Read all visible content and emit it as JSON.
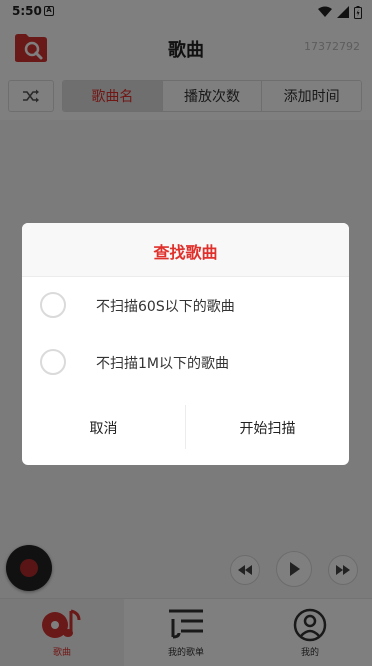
{
  "status_bar": {
    "time": "5:50",
    "notification_badge": "A",
    "icons": [
      "wifi-icon",
      "signal-icon",
      "battery-icon"
    ]
  },
  "header": {
    "title": "歌曲",
    "id_text": "17372792",
    "scan_icon": "folder-search-icon"
  },
  "sort_bar": {
    "shuffle_icon": "shuffle-icon",
    "tabs": [
      {
        "label": "歌曲名",
        "active": true
      },
      {
        "label": "播放次数",
        "active": false
      },
      {
        "label": "添加时间",
        "active": false
      }
    ]
  },
  "player": {
    "controls": [
      "rewind-icon",
      "play-icon",
      "fast-forward-icon"
    ]
  },
  "bottom_nav": {
    "items": [
      {
        "label": "歌曲",
        "icon": "music-disc-icon",
        "active": true
      },
      {
        "label": "我的歌单",
        "icon": "playlist-icon",
        "active": false
      },
      {
        "label": "我的",
        "icon": "profile-icon",
        "active": false
      }
    ]
  },
  "dialog": {
    "title": "查找歌曲",
    "options": [
      {
        "label": "不扫描60S以下的歌曲",
        "checked": false
      },
      {
        "label": "不扫描1M以下的歌曲",
        "checked": false
      }
    ],
    "cancel_label": "取消",
    "confirm_label": "开始扫描"
  },
  "colors": {
    "accent": "#e0302c",
    "overlay": "rgba(0,0,0,0.5)"
  }
}
